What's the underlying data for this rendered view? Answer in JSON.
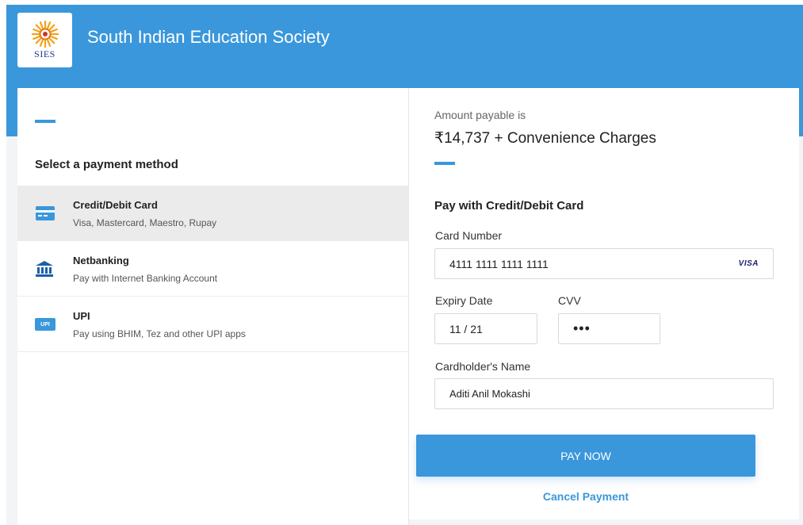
{
  "header": {
    "org_name": "South Indian Education Society",
    "logo_text": "SIES"
  },
  "payment_methods": {
    "heading": "Select a payment method",
    "items": [
      {
        "title": "Credit/Debit Card",
        "subtitle": "Visa, Mastercard, Maestro, Rupay",
        "icon": "card-icon",
        "selected": true
      },
      {
        "title": "Netbanking",
        "subtitle": "Pay with Internet Banking Account",
        "icon": "bank-icon",
        "selected": false
      },
      {
        "title": "UPI",
        "subtitle": "Pay using BHIM, Tez and other UPI apps",
        "icon": "upi-icon",
        "badge": "UPI",
        "selected": false
      }
    ]
  },
  "amount": {
    "label": "Amount payable is",
    "value": "₹14,737 + Convenience Charges"
  },
  "form": {
    "heading": "Pay with Credit/Debit Card",
    "card_number_label": "Card Number",
    "card_number": "4111 1111 1111 1111",
    "card_brand": "VISA",
    "expiry_label": "Expiry Date",
    "expiry": "11 / 21",
    "cvv_label": "CVV",
    "cvv": "•••",
    "name_label": "Cardholder's Name",
    "name": "Aditi Anil Mokashi",
    "pay_button": "PAY NOW",
    "cancel": "Cancel Payment"
  },
  "colors": {
    "accent": "#3a97db",
    "selected_bg": "#ebebeb"
  }
}
